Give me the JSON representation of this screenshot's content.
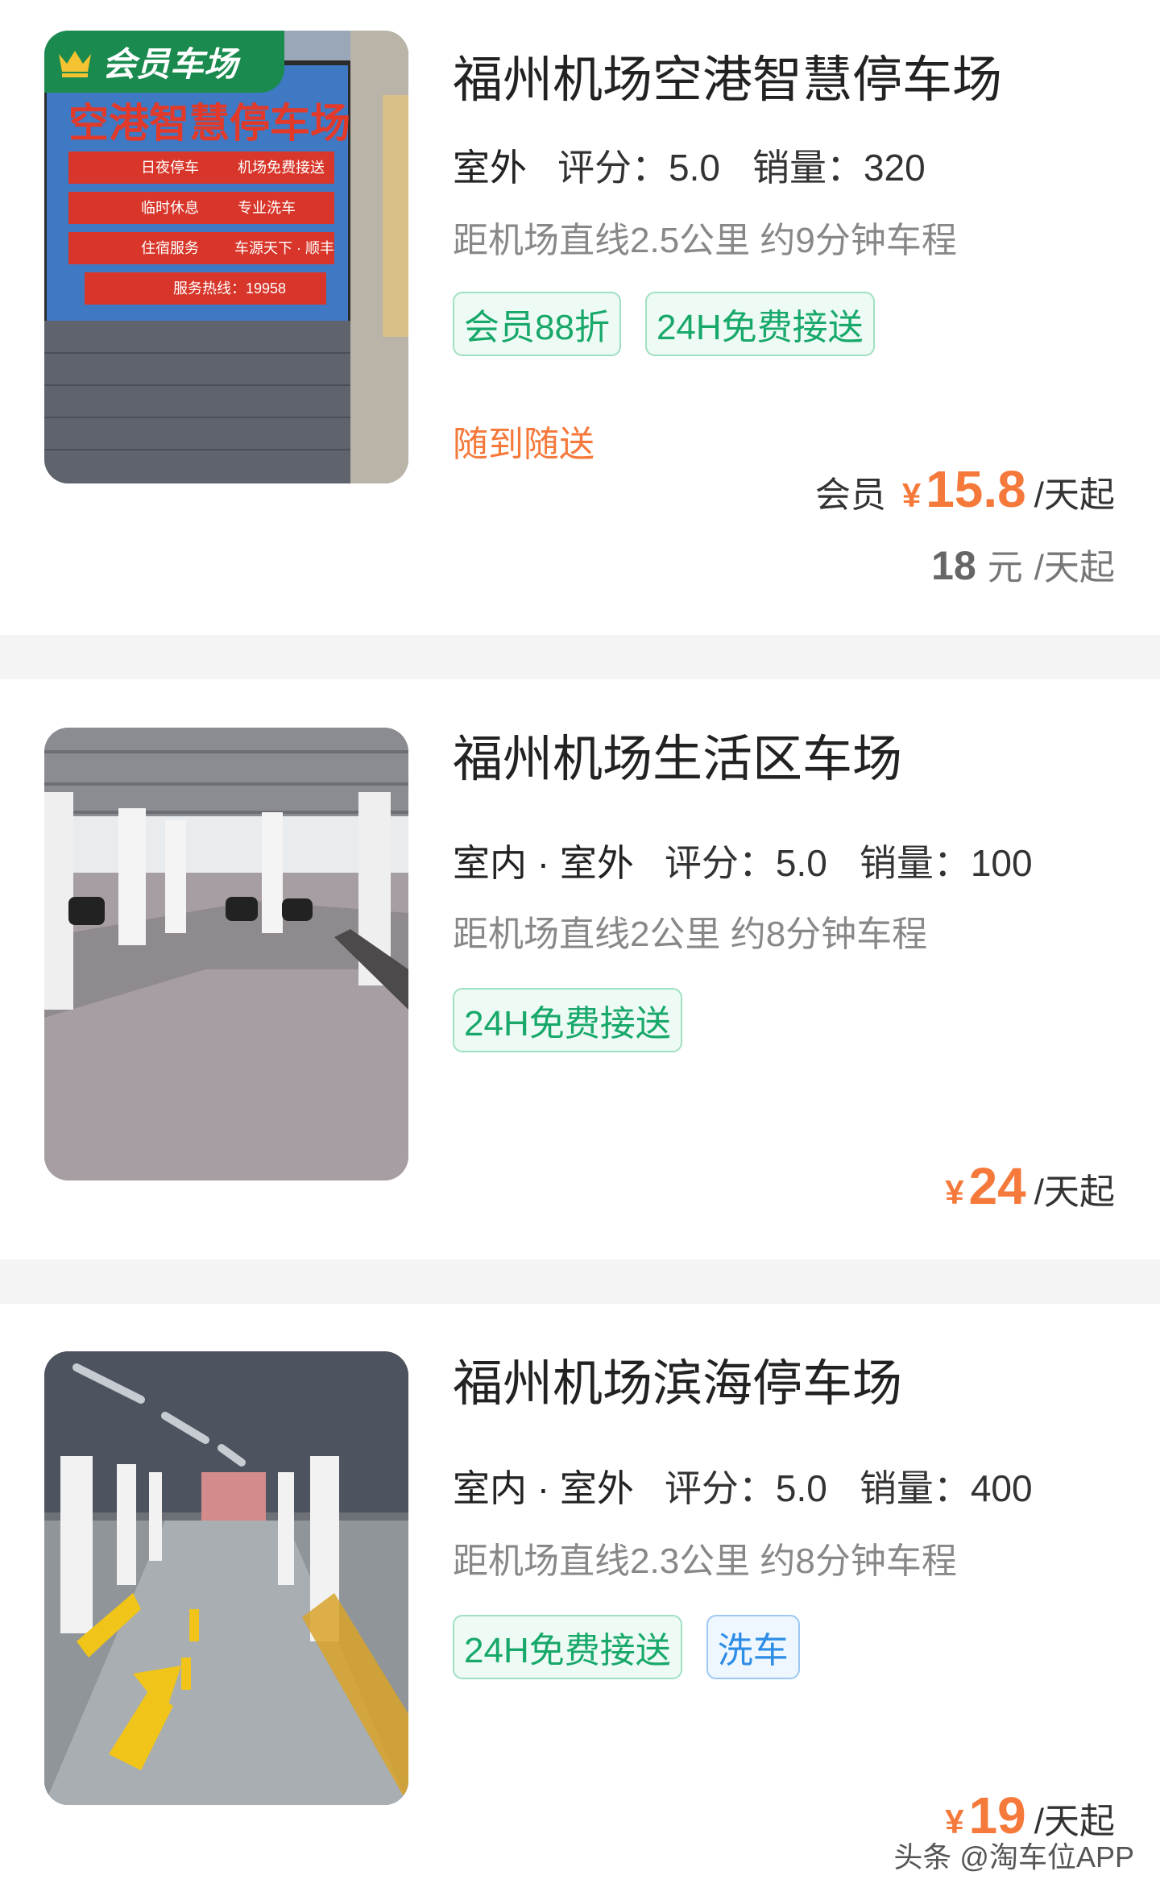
{
  "lots": [
    {
      "badge": "会员车场",
      "name": "福州机场空港智慧停车场",
      "location": "室外",
      "rating": "评分：5.0",
      "sales": "销量：320",
      "distance": "距机场直线2.5公里 约9分钟车程",
      "tags": [
        "会员88折",
        "24H免费接送"
      ],
      "promo": "随到随送",
      "member_label": "会员",
      "currency": "¥",
      "price": "15.8",
      "unit": "/天起",
      "orig_price": "18",
      "orig_currency": "元",
      "orig_unit": "/天起",
      "photo_text": [
        "空港智慧停车场",
        "日夜停车",
        "机场免费接送",
        "临时休息",
        "专业洗车",
        "住宿服务",
        "车源天下 · 顺丰",
        "服务热线：19958"
      ]
    },
    {
      "name": "福州机场生活区车场",
      "location": "室内 · 室外",
      "rating": "评分：5.0",
      "sales": "销量：100",
      "distance": "距机场直线2公里 约8分钟车程",
      "tags": [
        "24H免费接送"
      ],
      "currency": "¥",
      "price": "24",
      "unit": "/天起"
    },
    {
      "name": "福州机场滨海停车场",
      "location": "室内 · 室外",
      "rating": "评分：5.0",
      "sales": "销量：400",
      "distance": "距机场直线2.3公里 约8分钟车程",
      "tags": [
        "24H免费接送",
        "洗车"
      ],
      "currency": "¥",
      "price": "19",
      "unit": "/天起"
    }
  ],
  "watermark": "头条 @淘车位APP",
  "colors": {
    "accent_orange": "#f5793b",
    "tag_green": "#17a86a",
    "tag_blue": "#2d8de6",
    "badge_green": "#1a8a4e"
  },
  "icons": {
    "badge_icon": "crown-icon"
  }
}
